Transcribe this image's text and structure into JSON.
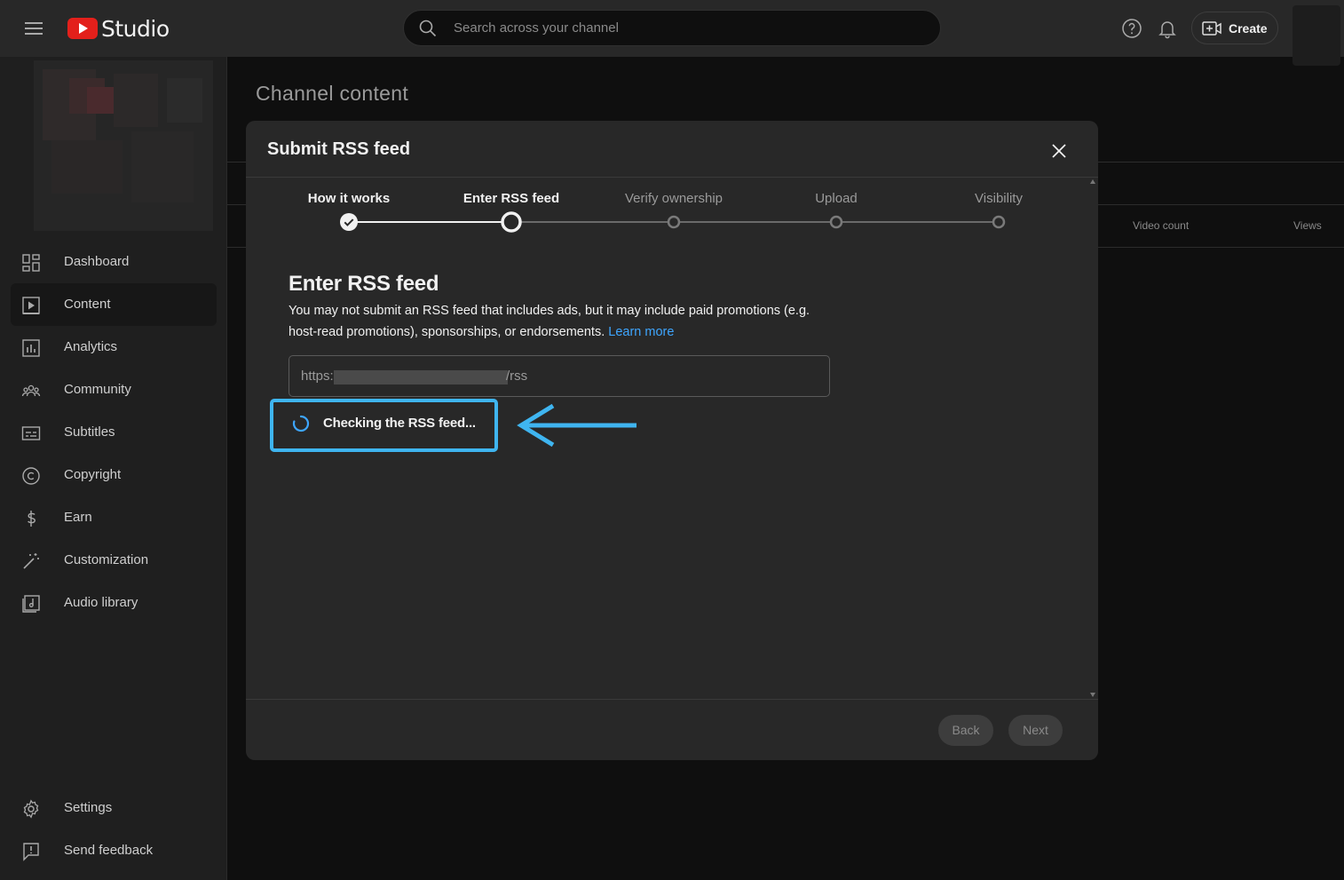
{
  "app": {
    "logo_text": "Studio"
  },
  "search": {
    "placeholder": "Search across your channel"
  },
  "header": {
    "create_label": "Create"
  },
  "sidebar": {
    "items": [
      {
        "label": "Dashboard"
      },
      {
        "label": "Content"
      },
      {
        "label": "Analytics"
      },
      {
        "label": "Community"
      },
      {
        "label": "Subtitles"
      },
      {
        "label": "Copyright"
      },
      {
        "label": "Earn"
      },
      {
        "label": "Customization"
      },
      {
        "label": "Audio library"
      }
    ],
    "bottom_items": [
      {
        "label": "Settings"
      },
      {
        "label": "Send feedback"
      }
    ]
  },
  "main": {
    "title": "Channel content",
    "columns": [
      "Video count",
      "Views"
    ]
  },
  "dialog": {
    "title": "Submit RSS feed",
    "steps": [
      {
        "label": "How it works",
        "state": "done"
      },
      {
        "label": "Enter RSS feed",
        "state": "current"
      },
      {
        "label": "Verify ownership",
        "state": "future"
      },
      {
        "label": "Upload",
        "state": "future"
      },
      {
        "label": "Visibility",
        "state": "future"
      }
    ],
    "section_title": "Enter RSS feed",
    "description": "You may not submit an RSS feed that includes ads, but it may include paid promotions (e.g. host-read promotions), sponsorships, or endorsements.",
    "learn_more": "Learn more",
    "rss_prefix": "https:",
    "rss_suffix": "/rss",
    "status_text": "Checking the RSS feed...",
    "back_label": "Back",
    "next_label": "Next"
  },
  "colors": {
    "accent_link": "#3ea6ff",
    "highlight_box": "#3fb5f0",
    "brand_red": "#e3201b"
  }
}
